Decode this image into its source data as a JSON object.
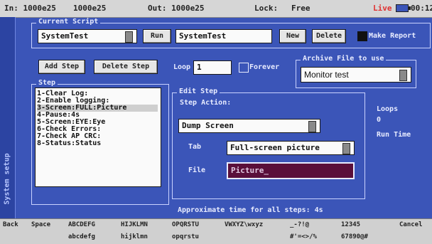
{
  "status_bar": {
    "in": "In: 1000e25",
    "in2": "1000e25",
    "out": "Out: 1000e25",
    "lock": "Lock:",
    "lock_value": "Free",
    "live": "Live",
    "time": "00:12"
  },
  "sidebar": {
    "label": "System setup"
  },
  "script": {
    "group_title": "Current Script",
    "selected": "SystemTest",
    "run_label": "Run",
    "name_value": "SystemTest",
    "new_label": "New",
    "delete_label": "Delete",
    "make_report_label": "Make Report"
  },
  "step_controls": {
    "add_label": "Add Step",
    "delete_label": "Delete Step",
    "loop_label": "Loop",
    "loop_value": "1",
    "forever_label": "Forever"
  },
  "archive": {
    "title": "Archive File to use",
    "value": "Monitor test"
  },
  "steps": {
    "title": "Step",
    "items": [
      "1-Clear Log:",
      "2-Enable logging:",
      "3-Screen:FULL:Picture",
      "4-Pause:4s",
      "5-Screen:EYE:Eye",
      "6-Check Errors:",
      "7-Check AP CRC:",
      "8-Status:Status"
    ],
    "selected_index": 2
  },
  "edit_step": {
    "title": "Edit Step",
    "action_label": "Step Action:",
    "action_value": "Dump Screen",
    "tab_label": "Tab",
    "tab_value": "Full-screen picture",
    "file_label": "File",
    "file_value": "Picture_"
  },
  "info": {
    "loops_label": "Loops",
    "loops_value": "0",
    "run_time_label": "Run Time",
    "approx_label": "Approximate time for all steps: 4s"
  },
  "keyboard": {
    "back": "Back",
    "space": "Space",
    "row1": [
      "ABCDEFG",
      "HIJKLMN",
      "OPQRSTU",
      "VWXYZ\\wxyz",
      "_-?!@",
      "12345"
    ],
    "row2": [
      "abcdefg",
      "hijklmn",
      "opqrstu",
      "#'=<>/%",
      "67890@#"
    ],
    "cancel": "Cancel"
  }
}
